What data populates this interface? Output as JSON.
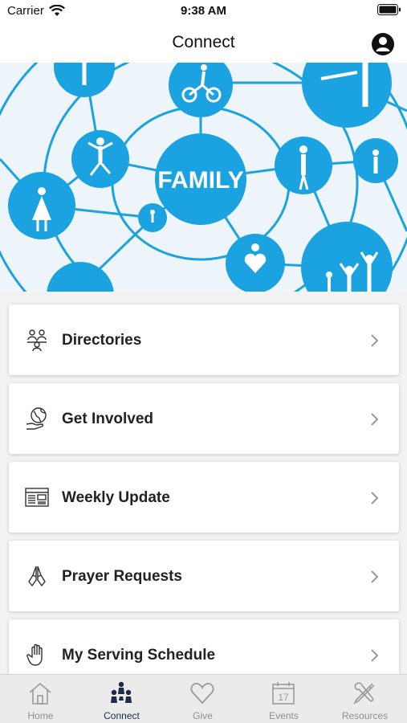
{
  "status_bar": {
    "carrier": "Carrier",
    "time": "9:38 AM"
  },
  "nav": {
    "title": "Connect"
  },
  "hero": {
    "center_text": "FAMILY",
    "accent_color": "#1aa3e0"
  },
  "menu": {
    "items": [
      {
        "label": "Directories",
        "icon": "people-directory-icon"
      },
      {
        "label": "Get Involved",
        "icon": "globe-hand-icon"
      },
      {
        "label": "Weekly Update",
        "icon": "newspaper-icon"
      },
      {
        "label": "Prayer Requests",
        "icon": "praying-hands-icon"
      },
      {
        "label": "My Serving Schedule",
        "icon": "raised-hand-icon"
      }
    ]
  },
  "tabs": {
    "active": "Connect",
    "items": [
      {
        "label": "Home",
        "icon": "home-icon"
      },
      {
        "label": "Connect",
        "icon": "connect-people-icon"
      },
      {
        "label": "Give",
        "icon": "heart-icon"
      },
      {
        "label": "Events",
        "icon": "calendar-icon",
        "calendar_day": "17"
      },
      {
        "label": "Resources",
        "icon": "tools-icon"
      }
    ]
  }
}
